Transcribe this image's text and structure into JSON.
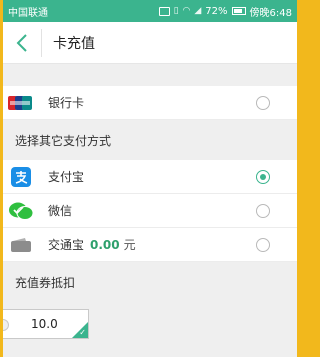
{
  "status": {
    "carrier": "中国联通",
    "battery": "72%",
    "time": "傍晚6:48"
  },
  "header": {
    "title": "卡充值"
  },
  "bank": {
    "label": "银行卡"
  },
  "other_section": {
    "title": "选择其它支付方式"
  },
  "payments": [
    {
      "label": "支付宝",
      "selected": true
    },
    {
      "label": "微信",
      "selected": false
    },
    {
      "label": "交通宝",
      "amount": "0.00",
      "unit": "元",
      "selected": false
    }
  ],
  "coupon_section": {
    "title": "充值券抵扣",
    "value": "10.0"
  },
  "colors": {
    "accent": "#3bb48e",
    "outer": "#f2b81c",
    "alipay": "#1a8ee6",
    "wechat": "#2fbf3f"
  }
}
